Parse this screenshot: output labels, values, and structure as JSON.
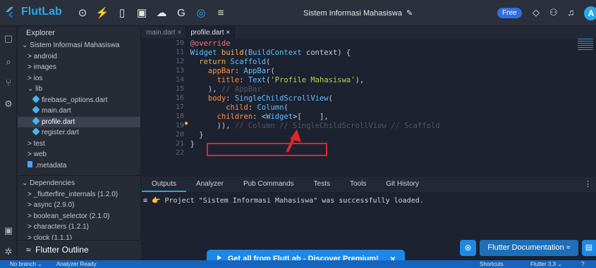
{
  "app": {
    "name": "FlutLab",
    "project_title": "Sistem Informasi Mahasiswa",
    "badge": "Free",
    "avatar_letter": "A"
  },
  "explorer": {
    "title": "Explorer",
    "items": [
      {
        "label": "Sistem Informasi Mahasiswa",
        "indent": 0,
        "prefix": "v"
      },
      {
        "label": "android",
        "indent": 1,
        "prefix": ">"
      },
      {
        "label": "images",
        "indent": 1,
        "prefix": ">"
      },
      {
        "label": "ios",
        "indent": 1,
        "prefix": ">"
      },
      {
        "label": "lib",
        "indent": 1,
        "prefix": "v"
      },
      {
        "label": "firebase_options.dart",
        "indent": 2,
        "prefix": "dart"
      },
      {
        "label": "main.dart",
        "indent": 2,
        "prefix": "dart"
      },
      {
        "label": "profile.dart",
        "indent": 2,
        "prefix": "dart",
        "selected": true
      },
      {
        "label": "register.dart",
        "indent": 2,
        "prefix": "dart"
      },
      {
        "label": "test",
        "indent": 1,
        "prefix": ">"
      },
      {
        "label": "web",
        "indent": 1,
        "prefix": ">"
      },
      {
        "label": ".metadata",
        "indent": 1,
        "prefix": "file"
      }
    ],
    "dependencies_title": "Dependencies",
    "dependencies": [
      "_flutterfire_internals (1.2.0)",
      "async (2.9.0)",
      "boolean_selector (2.1.0)",
      "characters (1.2.1)",
      "clock (1.1.1)"
    ],
    "outline_title": "Flutter Outline"
  },
  "editor": {
    "tabs": [
      {
        "label": "main.dart ×",
        "active": false
      },
      {
        "label": "profile.dart ×",
        "active": true
      }
    ],
    "line_numbers": [
      "10",
      "11",
      "12",
      "13",
      "14",
      "15",
      "16",
      "17",
      "18",
      "19",
      "20",
      "21",
      "22"
    ],
    "lines": [
      [
        [
          "an",
          "  @override"
        ]
      ],
      [
        [
          "ty",
          "  Widget "
        ],
        [
          "fn",
          "build"
        ],
        [
          "",
          "("
        ],
        [
          "ty",
          "BuildContext"
        ],
        [
          "",
          " context) {"
        ]
      ],
      [
        [
          "kw",
          "    return "
        ],
        [
          "ty",
          "Scaffold"
        ],
        [
          "",
          "("
        ]
      ],
      [
        [
          "pr",
          "      appBar"
        ],
        [
          "",
          ": "
        ],
        [
          "ty",
          "AppBar"
        ],
        [
          "",
          "("
        ]
      ],
      [
        [
          "pr",
          "        title"
        ],
        [
          "",
          ": "
        ],
        [
          "ty",
          "Text"
        ],
        [
          "",
          "("
        ],
        [
          "st",
          "'Profile Mahasiswa'"
        ],
        [
          "",
          "),"
        ]
      ],
      [
        [
          "",
          "      ), "
        ],
        [
          "cm",
          "// AppBar"
        ]
      ],
      [
        [
          "pr",
          "      body"
        ],
        [
          "",
          ": "
        ],
        [
          "ty",
          "SingleChildScrollView"
        ],
        [
          "",
          "("
        ]
      ],
      [
        [
          "pr",
          "          child"
        ],
        [
          "",
          ": "
        ],
        [
          "ty",
          "Column"
        ],
        [
          "",
          "("
        ]
      ],
      [
        [
          "pr",
          "        children"
        ],
        [
          "",
          ": <"
        ],
        [
          "ty",
          "Widget"
        ],
        [
          "",
          ">[    ],"
        ]
      ],
      [
        [
          "",
          "        )), "
        ],
        [
          "cm",
          "// Column // SingleChildScrollView // Scaffold"
        ]
      ],
      [
        [
          "",
          "    }"
        ]
      ],
      [
        [
          "",
          "  }"
        ]
      ],
      [
        [
          "",
          ""
        ]
      ]
    ]
  },
  "bottom": {
    "tabs": [
      "Outputs",
      "Analyzer",
      "Pub Commands",
      "Tests",
      "Tools",
      "Git History"
    ],
    "output": "≡ 👉 Project \"Sistem Informasi Mahasiswa\" was successfully loaded."
  },
  "promo": {
    "label": "Get all from FlutLab - Discover Premium!",
    "close": "×"
  },
  "flutter_doc": {
    "label": "Flutter Documentation ≈"
  },
  "status": {
    "branch": "No branch ⌄",
    "analyzer": "Analyzer Ready",
    "shortcuts": "Shortcuts",
    "flutter": "Flutter 3.3 ⌄"
  },
  "colors": {
    "accent": "#2aa7e6",
    "status_bar": "#1565c0",
    "highlight": "#e0262b"
  }
}
